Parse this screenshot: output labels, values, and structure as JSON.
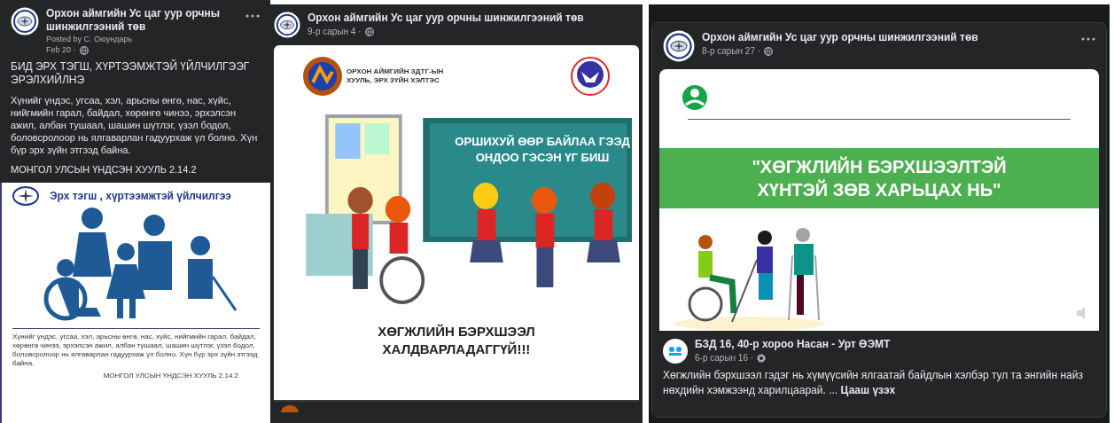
{
  "posts": [
    {
      "kind": "text_with_poster",
      "page_name": "Орхон аймгийн Ус цаг уур орчны шинжилгээний төв",
      "posted_by": "Posted by С. Оюундарь",
      "date": "Feb 20 ·",
      "heading": "БИД ЭРХ ТЭГШ, ХҮРТЭЭМЖТЭЙ ҮЙЛЧИЛГЭЭГ ЭРЭЛХИЙЛНЭ",
      "body": "Хүнийг үндэс, угсаа, хэл, арьсны өнгө, нас, хүйс, нийгмийн гарал, байдал, хөрөнгө чинээ, эрхэлсэн ажил, албан тушаал, шашин шүтлэг, үзэл бодол, боловсролоор нь ялгаварлан гадуурхаж үл болно.  Хүн бүр эрх зүйн этгээд байна.",
      "footer": "МОНГОЛ УЛСЫН ҮНДСЭН ХУУЛЬ  2.14.2",
      "poster": {
        "title": "Эрх тэгш , хүртээмжтэй үйлчилгээ",
        "caption": "Хүнийг үндэс, угсаа, хэл, арьсны өнгө, нас, хүйс, нийгмийн гарал, байдал, хөрөнгө чинээ, эрхэлсэн ажил, албан тушаал, шашин шүтлэг, үзэл бодол, боловсролоор нь ялгаварлан гадуурхаж үл болно.  Хүн бүр эрх зүйн этгээд байна.",
        "source": "МОНГОЛ УЛСЫН ҮНДСЭН ХУУЛЬ 2.14.2"
      }
    },
    {
      "kind": "image_post",
      "page_name": "Орхон аймгийн Ус цаг уур орчны шинжилгээний төв",
      "date": "9-р сарын 4 ·",
      "poster": {
        "org_lines": [
          "ОРХОН АЙМГИЙН ЗДТГ-ЫН",
          "ХУУЛЬ, ЭРХ ЗҮЙН ХЭЛТЭС"
        ],
        "board_text": "ОРШИХУЙ ӨӨР БАЙЛАА ГЭЭД ОНДОО ГЭСЭН ҮГ БИШ",
        "slogan": "ХӨГЖЛИЙН БЭРХШЭЭЛ ХАЛДВАРЛАДАГГҮЙ!!!"
      }
    },
    {
      "kind": "shared_video",
      "page_name": "Орхон аймгийн Ус цаг уур орчны шинжилгээний төв",
      "date": "8-р сарын 27 ·",
      "poster": {
        "banner": "\"ХӨГЖЛИЙН БЭРХШЭЭЛТЭЙ ХҮНТЭЙ ЗӨВ ХАРЬЦАХ НЬ\""
      },
      "shared": {
        "author": "БЗД 16, 40-р хороо Насан - Урт ӨЭМТ",
        "date": "6-р сарын 16 ·",
        "text": "Хөгжлийн бэрхшээл гэдэг нь хүмүүсийн ялгаатай байдлын хэлбэр тул та энгийн найз нөхдийн хэмжээнд харилцаарай. ...",
        "more": "Цааш үзэх"
      }
    }
  ]
}
